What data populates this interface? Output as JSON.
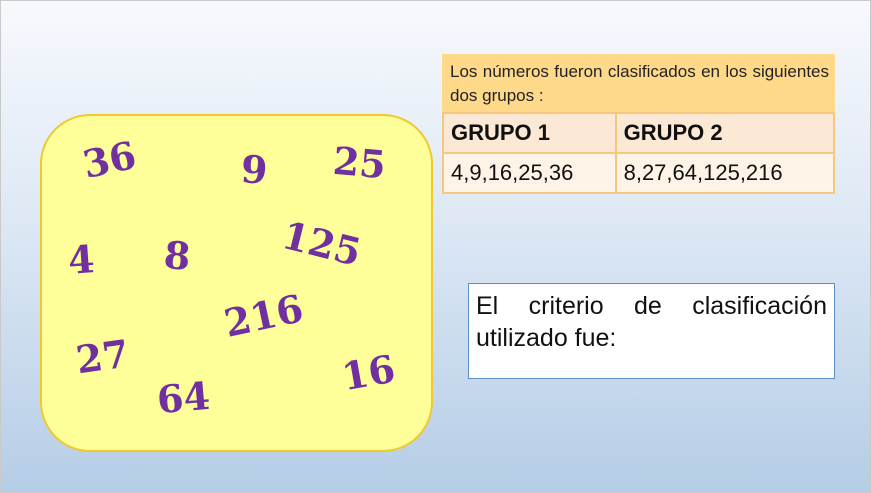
{
  "numbers_box": {
    "numbers": [
      "36",
      "9",
      "25",
      "4",
      "8",
      "125",
      "216",
      "27",
      "64",
      "16"
    ]
  },
  "groups_table": {
    "intro": "Los números fueron clasificados en los siguientes dos grupos :",
    "headers": [
      "GRUPO 1",
      "GRUPO 2"
    ],
    "values": [
      "4,9,16,25,36",
      "8,27,64,125,216"
    ]
  },
  "criterio": {
    "text": "El criterio de clasificación utilizado fue:"
  },
  "colors": {
    "number_color": "#7030a0",
    "box_fill": "#ffff99",
    "box_border": "#f0c830",
    "table_header_fill": "#ffd98a",
    "table_cell_fill": "#fdf3e6"
  }
}
